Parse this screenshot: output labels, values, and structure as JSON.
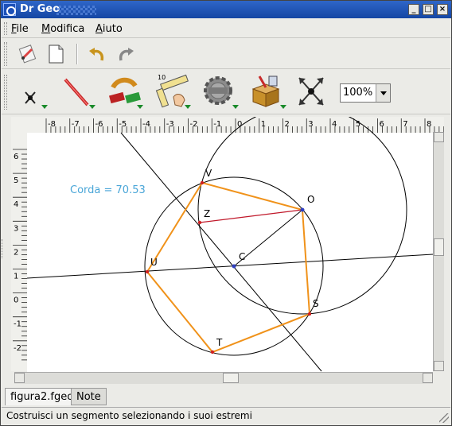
{
  "window": {
    "title": "Dr Geo"
  },
  "menubar": {
    "items": [
      {
        "label": "File",
        "mnemonic": "F"
      },
      {
        "label": "Modifica",
        "mnemonic": "M"
      },
      {
        "label": "Aiuto",
        "mnemonic": "A"
      }
    ]
  },
  "toolbar_primary": {
    "icons": [
      "pencil-paper-icon",
      "new-document-icon",
      "undo-icon",
      "redo-icon"
    ]
  },
  "toolbar_tools": {
    "icons": [
      "point-tool-icon",
      "line-tool-icon",
      "transformation-tool-icon",
      "measure-tool-icon",
      "macro-gear-icon",
      "script-box-icon",
      "move-tool-icon"
    ]
  },
  "zoom": {
    "value": "100%"
  },
  "ruler": {
    "x_ticks": [
      "-8",
      "-7",
      "-6",
      "-5",
      "-4",
      "-3",
      "-2",
      "-1",
      "0",
      "1",
      "2",
      "3",
      "4",
      "5",
      "6",
      "7",
      "8"
    ],
    "y_ticks": [
      "6",
      "5",
      "4",
      "3",
      "2",
      "1",
      "0",
      "-1",
      "-2"
    ]
  },
  "canvas": {
    "measure_label": "Corda = 70.53",
    "point_labels": {
      "V": "V",
      "O": "O",
      "Z": "Z",
      "U": "U",
      "C": "C",
      "S": "S",
      "T": "T"
    }
  },
  "colors": {
    "polygon": "#f0921a",
    "chord": "#c0182a",
    "measure_text": "#4aa6d8",
    "titlebar": "#1c52b4"
  },
  "tabs": [
    {
      "label": "figura2.fgeo",
      "active": true
    },
    {
      "label": "Note",
      "active": false
    }
  ],
  "status": {
    "text": "Costruisci un segmento selezionando i suoi estremi"
  }
}
